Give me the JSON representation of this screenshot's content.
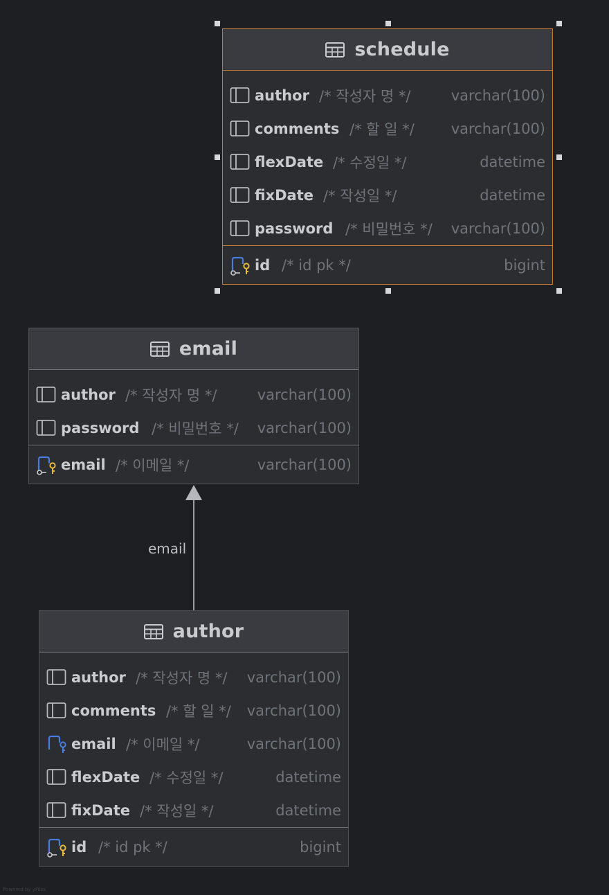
{
  "diagram": {
    "tables": [
      {
        "id": "schedule",
        "name": "schedule",
        "selected": true,
        "fields": [
          {
            "name": "author",
            "comment": "/* 작성자 명 */",
            "type": "varchar(100)",
            "icon": "column-icon"
          },
          {
            "name": "comments",
            "comment": "/* 할 일 */",
            "type": "varchar(100)",
            "icon": "column-icon"
          },
          {
            "name": "flexDate",
            "comment": "/* 수정일 */",
            "type": "datetime",
            "icon": "column-icon"
          },
          {
            "name": "fixDate",
            "comment": "/* 작성일 */",
            "type": "datetime",
            "icon": "column-icon"
          },
          {
            "name": "password",
            "comment": "/* 비밀번호 */",
            "type": "varchar(100)",
            "icon": "column-icon"
          }
        ],
        "keys": [
          {
            "name": "id",
            "comment": "/* id pk */",
            "type": "bigint",
            "icon": "primary-key-icon"
          }
        ]
      },
      {
        "id": "email",
        "name": "email",
        "selected": false,
        "fields": [
          {
            "name": "author",
            "comment": "/* 작성자 명 */",
            "type": "varchar(100)",
            "icon": "column-icon"
          },
          {
            "name": "password",
            "comment": "/* 비밀번호 */",
            "type": "varchar(100)",
            "icon": "column-icon"
          }
        ],
        "keys": [
          {
            "name": "email",
            "comment": "/* 이메일 */",
            "type": "varchar(100)",
            "icon": "primary-key-icon"
          }
        ]
      },
      {
        "id": "author",
        "name": "author",
        "selected": false,
        "fields": [
          {
            "name": "author",
            "comment": "/* 작성자 명 */",
            "type": "varchar(100)",
            "icon": "column-icon"
          },
          {
            "name": "comments",
            "comment": "/* 할 일 */",
            "type": "varchar(100)",
            "icon": "column-icon"
          },
          {
            "name": "email",
            "comment": "/* 이메일 */",
            "type": "varchar(100)",
            "icon": "foreign-key-icon"
          },
          {
            "name": "flexDate",
            "comment": "/* 수정일 */",
            "type": "datetime",
            "icon": "column-icon"
          },
          {
            "name": "fixDate",
            "comment": "/* 작성일 */",
            "type": "datetime",
            "icon": "column-icon"
          }
        ],
        "keys": [
          {
            "name": "id",
            "comment": "/* id pk */",
            "type": "bigint",
            "icon": "primary-key-icon"
          }
        ]
      }
    ],
    "relations": [
      {
        "from": "author",
        "to": "email",
        "label": "email"
      }
    ],
    "footer": "Powered by yFiles"
  },
  "colors": {
    "background": "#1e1f22",
    "entity_body": "#2b2d30",
    "entity_header": "#393b40",
    "selection": "#c47a2f",
    "text_primary": "#c9cbcf",
    "text_muted": "#6f737a",
    "key_blue": "#4a7ce0",
    "key_gold": "#e7b93a"
  }
}
